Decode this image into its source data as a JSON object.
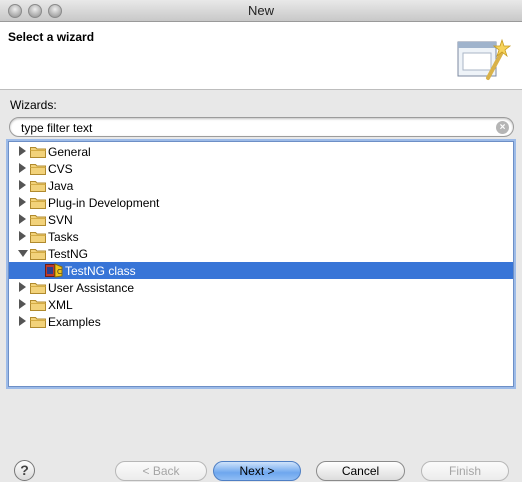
{
  "window": {
    "title": "New"
  },
  "header": {
    "title": "Select a wizard"
  },
  "wizards_label": "Wizards:",
  "filter": {
    "value": "type filter text"
  },
  "tree": {
    "items": [
      {
        "label": "General",
        "expanded": false
      },
      {
        "label": "CVS",
        "expanded": false
      },
      {
        "label": "Java",
        "expanded": false
      },
      {
        "label": "Plug-in Development",
        "expanded": false
      },
      {
        "label": "SVN",
        "expanded": false
      },
      {
        "label": "Tasks",
        "expanded": false
      },
      {
        "label": "TestNG",
        "expanded": true
      },
      {
        "label": "TestNG class",
        "selected": true,
        "child": true
      },
      {
        "label": "User Assistance",
        "expanded": false
      },
      {
        "label": "XML",
        "expanded": false
      },
      {
        "label": "Examples",
        "expanded": false
      }
    ]
  },
  "buttons": {
    "help": "?",
    "back": "< Back",
    "next": "Next >",
    "cancel": "Cancel",
    "finish": "Finish"
  },
  "colors": {
    "selection": "#3875d7",
    "default_button": "#6ea7ee",
    "folder": "#e9c46a"
  }
}
